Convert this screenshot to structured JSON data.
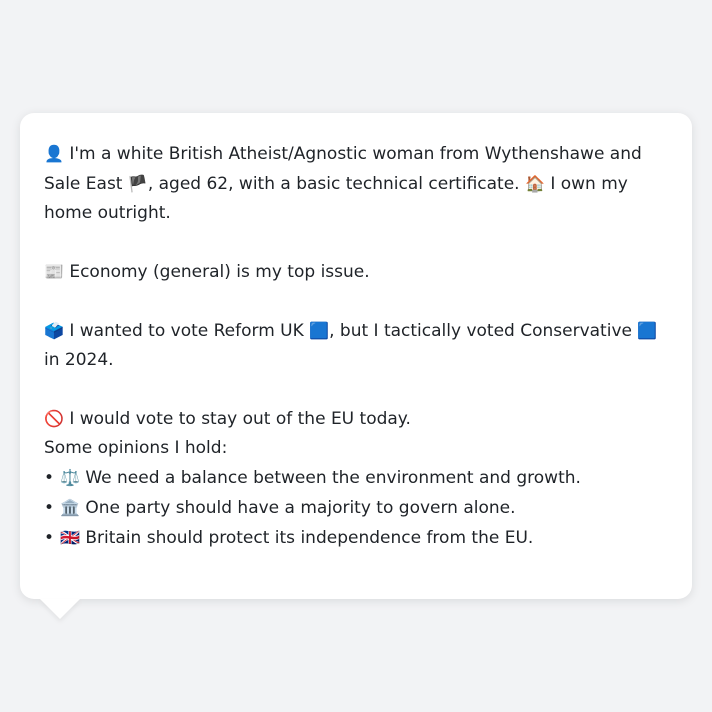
{
  "profile": {
    "identity": {
      "icon": "person-silhouette-icon",
      "glyph": "👤",
      "text_a": "I'm a white British Atheist/Agnostic woman from Wythenshawe and Sale East",
      "flag": "🏴",
      "text_b": ", aged 62, with a basic technical certificate.",
      "home_glyph": "🏠",
      "text_c": "I own my home outright."
    },
    "top_issue": {
      "icon": "newspaper-icon",
      "glyph": "📰",
      "text": "Economy (general) is my top issue."
    },
    "vote": {
      "icon": "ballot-box-icon",
      "glyph": "🗳️",
      "text_a": "I wanted to vote Reform UK",
      "party_a_glyph": "🟦",
      "text_b": ", but I tactically voted Conservative",
      "party_b_glyph": "🟦",
      "text_c": "in 2024."
    },
    "eu": {
      "icon": "prohibited-icon",
      "glyph": "🚫",
      "text": "I would vote to stay out of the EU today."
    },
    "opinions": {
      "heading": "Some opinions I hold:",
      "bullet": "•",
      "items": [
        {
          "icon": "scales-icon",
          "glyph": "⚖️",
          "text": "We need a balance between the environment and growth."
        },
        {
          "icon": "classical-building-icon",
          "glyph": "🏛️",
          "text": "One party should have a majority to govern alone."
        },
        {
          "icon": "uk-flag-icon",
          "glyph": "🇬🇧",
          "text": "Britain should protect its independence from the EU."
        }
      ]
    }
  }
}
